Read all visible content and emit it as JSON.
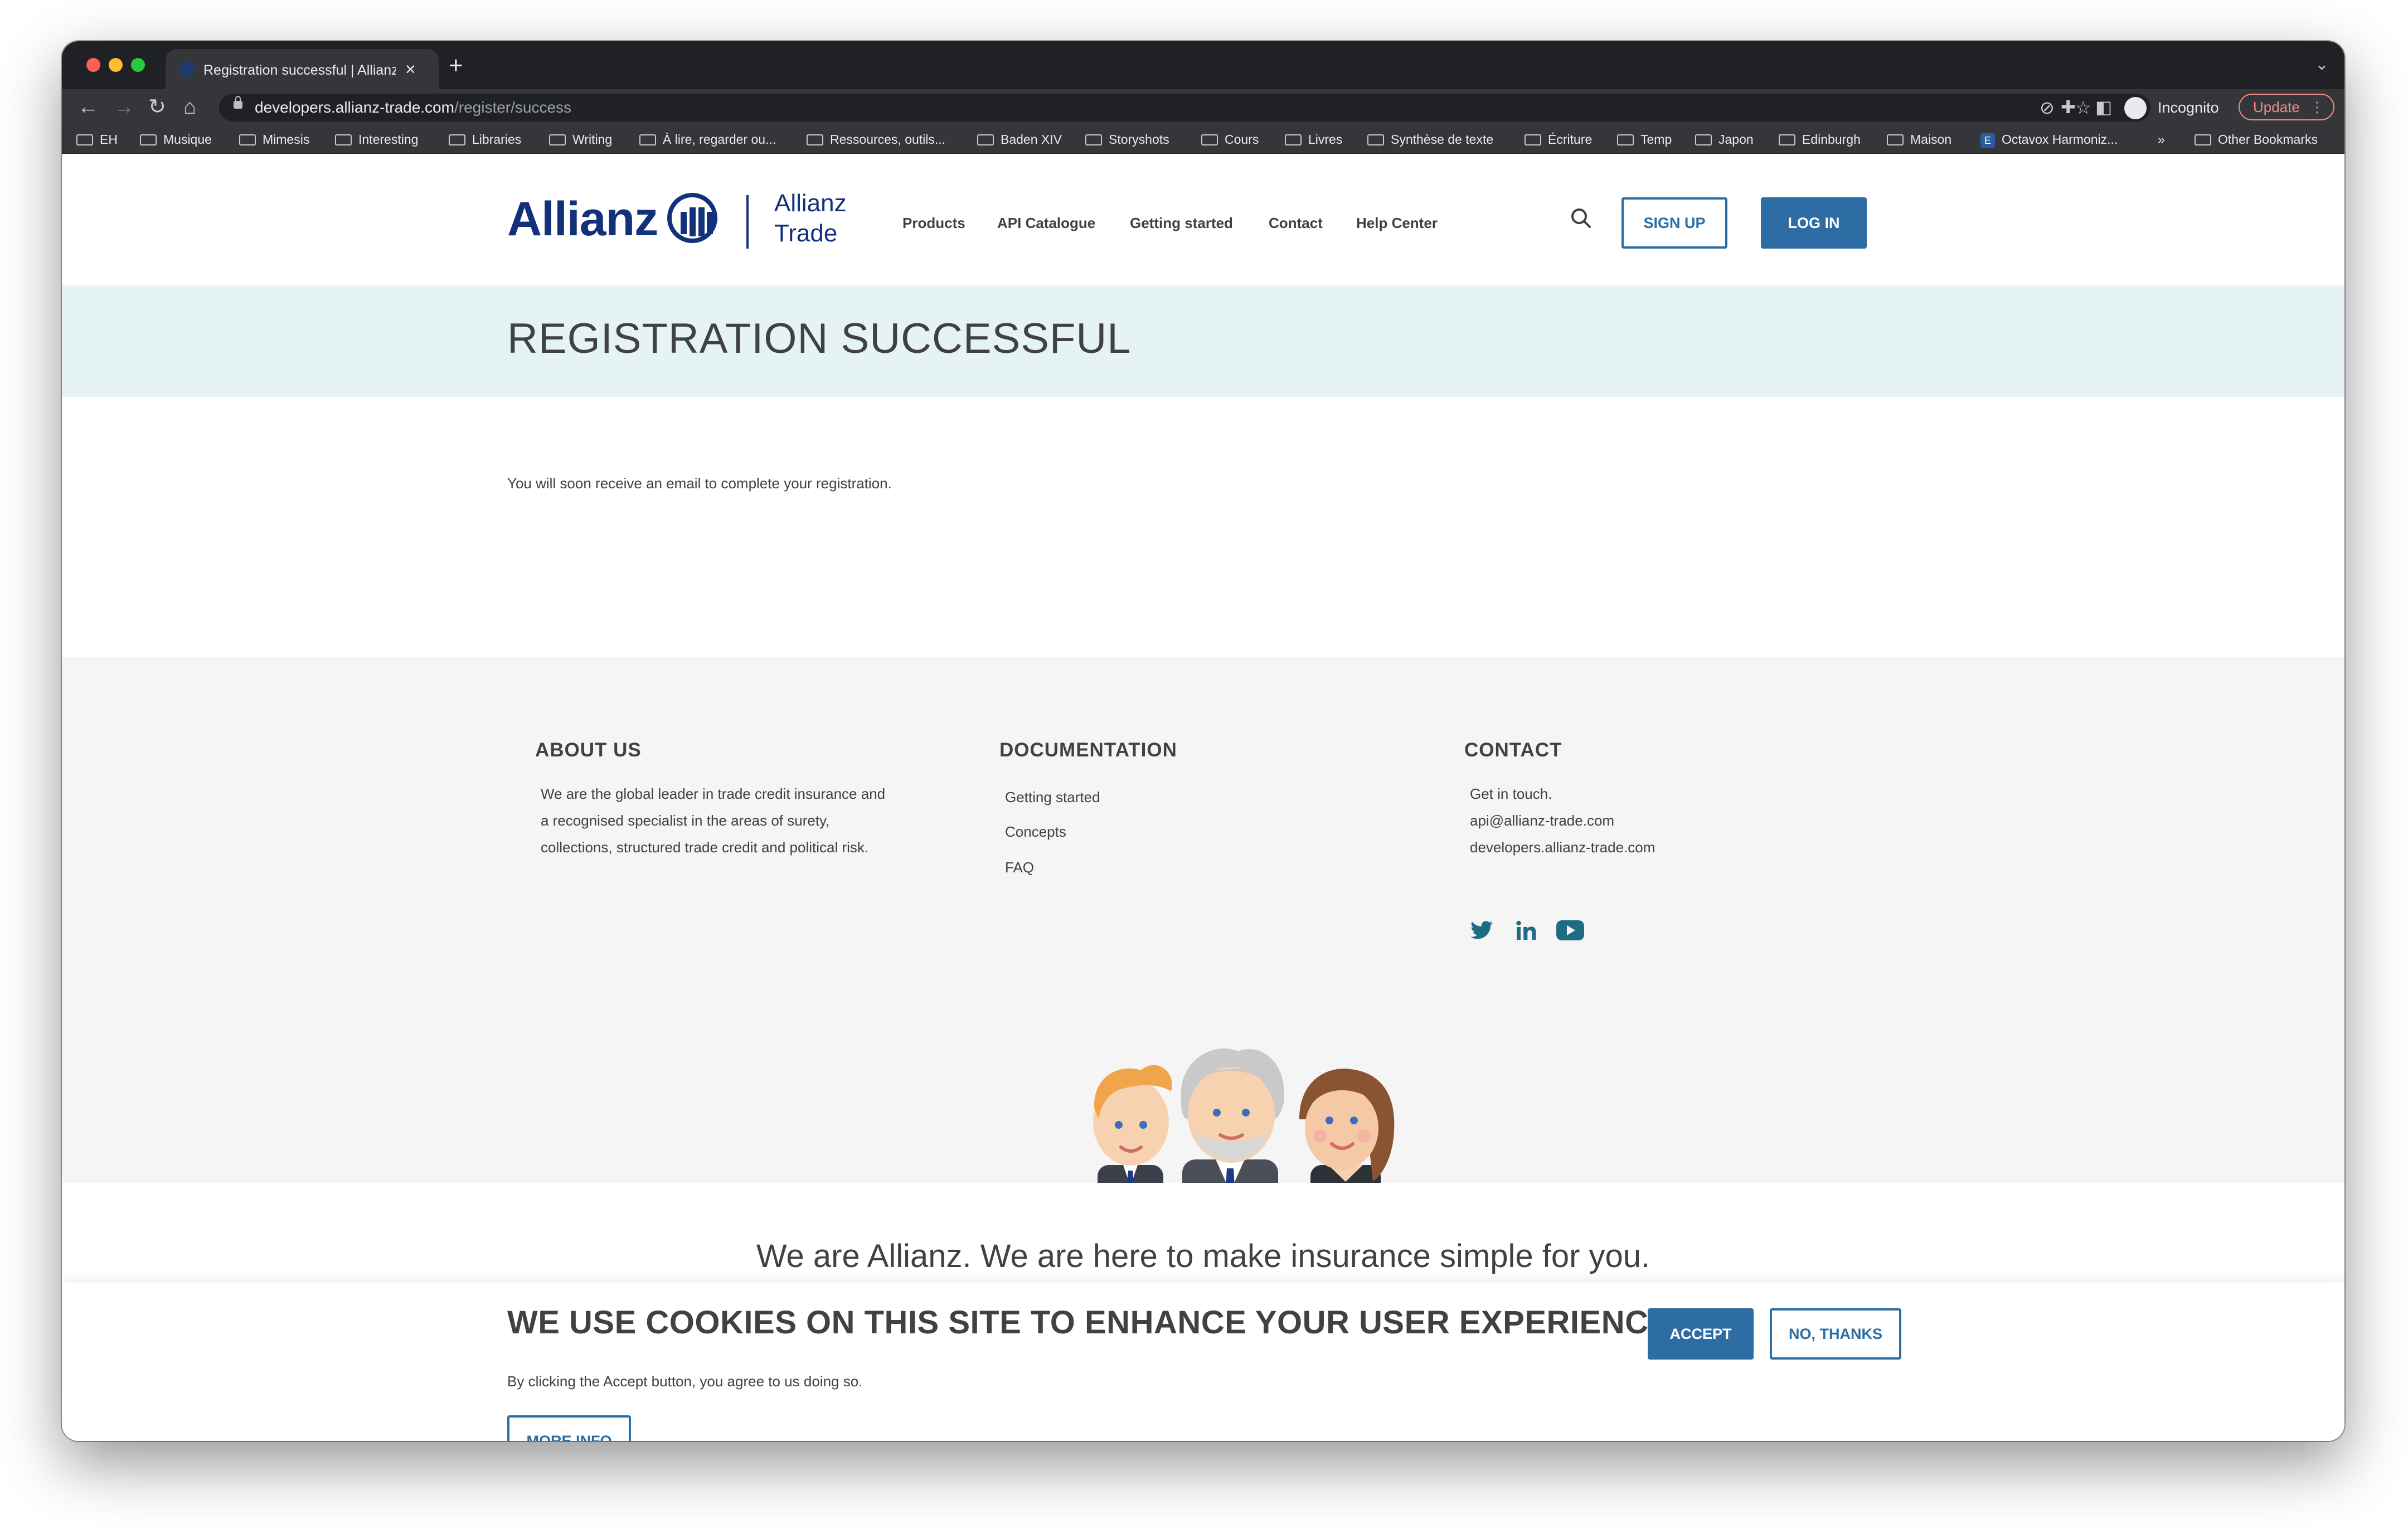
{
  "browser": {
    "tab_title": "Registration successful | Allianz",
    "url_host": "developers.allianz-trade.com",
    "url_path": "/register/success",
    "incognito_label": "Incognito",
    "update_label": "Update",
    "bookmarks": [
      "EH",
      "Musique",
      "Mimesis",
      "Interesting",
      "Libraries",
      "Writing",
      "À lire, regarder ou...",
      "Ressources, outils...",
      "Baden XIV",
      "Storyshots",
      "Cours",
      "Livres",
      "Synthèse de texte",
      "Écriture",
      "Temp",
      "Japon",
      "Edinburgh",
      "Maison",
      "Octavox Harmoniz..."
    ],
    "bookmarks_overflow": "»",
    "other_bookmarks": "Other Bookmarks"
  },
  "header": {
    "logo_word": "Allianz",
    "logo_trade_line1": "Allianz",
    "logo_trade_line2": "Trade",
    "nav": [
      "Products",
      "API Catalogue",
      "Getting started",
      "Contact",
      "Help Center"
    ],
    "signup_label": "SIGN UP",
    "login_label": "LOG IN"
  },
  "banner": {
    "title": "REGISTRATION SUCCESSFUL"
  },
  "main": {
    "message": "You will soon receive an email to complete your registration."
  },
  "footer": {
    "about": {
      "title": "ABOUT US",
      "lines": [
        "We are the global leader in trade credit insurance and",
        "a recognised specialist in the areas of surety,",
        "collections, structured trade credit and political risk."
      ]
    },
    "documentation": {
      "title": "DOCUMENTATION",
      "links": [
        "Getting started",
        "Concepts",
        "FAQ"
      ]
    },
    "contact": {
      "title": "CONTACT",
      "lines": [
        "Get in touch.",
        "api@allianz-trade.com",
        "developers.allianz-trade.com"
      ],
      "social": [
        "twitter-icon",
        "linkedin-icon",
        "youtube-icon"
      ]
    },
    "tagline": "We are Allianz. We are here to make insurance simple for you."
  },
  "cookie": {
    "title": "WE USE COOKIES ON THIS SITE TO ENHANCE YOUR USER EXPERIENCE",
    "text": "By clicking the Accept button, you agree to us doing so.",
    "accept_label": "ACCEPT",
    "decline_label": "NO, THANKS",
    "more_info_label": "MORE INFO"
  },
  "colors": {
    "brand_blue": "#13307a",
    "button_blue": "#2e6ca4",
    "banner_bg": "#e6f3f5",
    "footer_bg": "#f5f5f5",
    "social_teal": "#1f6b84"
  }
}
